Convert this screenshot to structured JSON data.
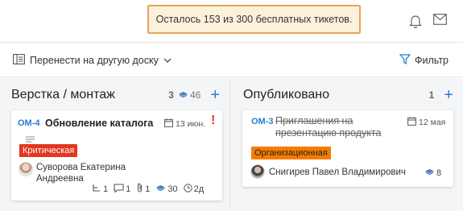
{
  "notice": {
    "text": "Осталось 153 из 300 бесплатных тикетов."
  },
  "toolbar": {
    "move_label": "Перенести на другую доску",
    "filter_label": "Фильтр"
  },
  "columns": [
    {
      "title": "Верстка / монтаж",
      "count": "3",
      "points": "46",
      "cards": [
        {
          "code": "ОМ-4",
          "title": "Обновление каталога",
          "date": "13 июн.",
          "tag": "Критическая",
          "assignee_line1": "Суворова Екатерина",
          "assignee_line2": "Андреевна",
          "stats": {
            "subtasks": "1",
            "comments": "1",
            "attachments": "1",
            "points": "30",
            "time": "2д"
          }
        }
      ]
    },
    {
      "title": "Опубликовано",
      "count": "1",
      "cards": [
        {
          "code": "ОМ-3",
          "title_line1": "Приглашения на",
          "title_line2": "презентацию продукта",
          "date": "12 мая",
          "tag": "Организационная",
          "assignee": "Снигирев Павел Владимирович",
          "points": "8"
        }
      ]
    }
  ],
  "colors": {
    "accent": "#2b7bd6",
    "critical": "#e2361f",
    "org": "#f57c00",
    "notice_border": "#e6a55a"
  }
}
